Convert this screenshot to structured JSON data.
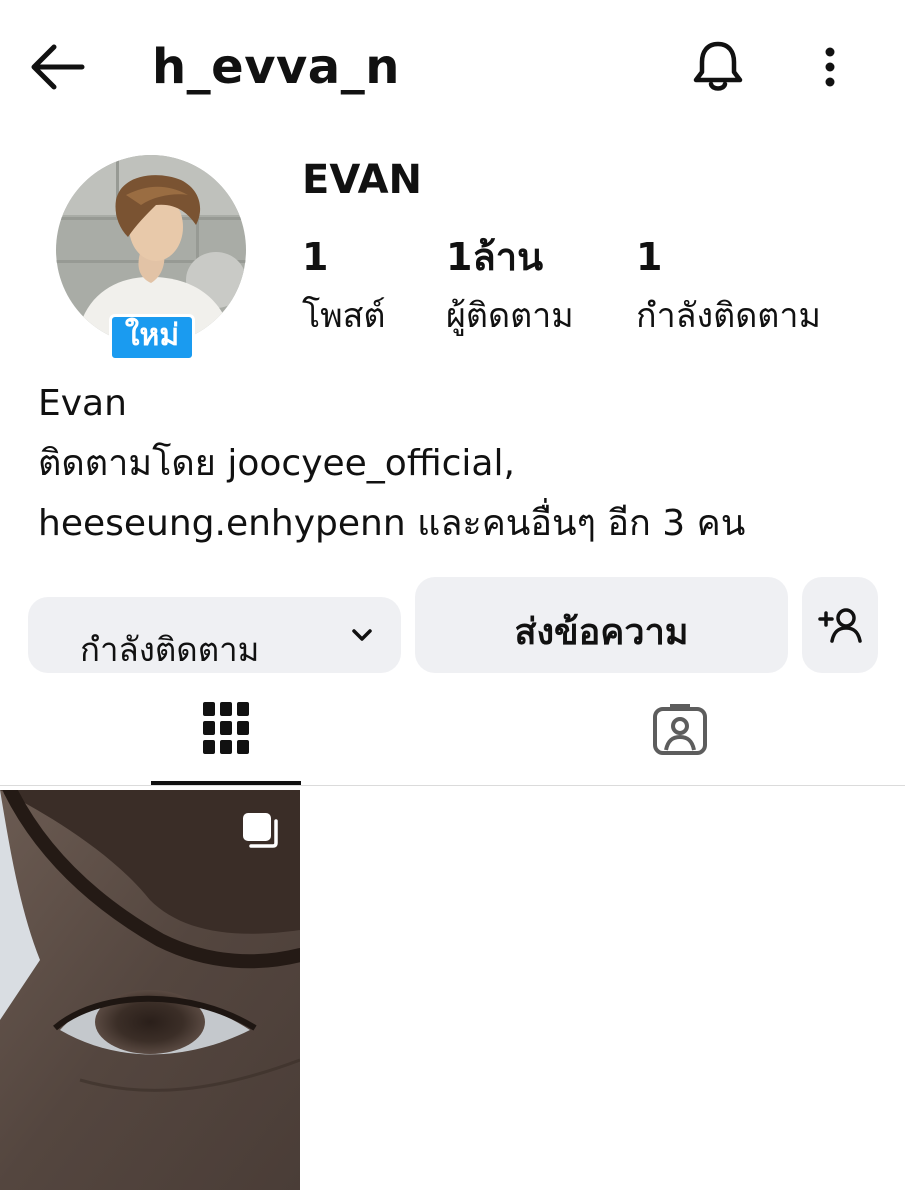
{
  "header": {
    "username": "h_evva_n",
    "icons": {
      "back": "arrow-left-icon",
      "notifications": "bell-icon",
      "more": "more-vertical-icon"
    }
  },
  "profile": {
    "display_name": "EVAN",
    "badge": "ใหม่",
    "stats": [
      {
        "value": "1",
        "label": "โพสต์"
      },
      {
        "value": "1ล้าน",
        "label": "ผู้ติดตาม"
      },
      {
        "value": "1",
        "label": "กำลังติดตาม"
      }
    ],
    "bio": {
      "name": "Evan",
      "followed_by_prefix": "ติดตามโดย",
      "followed_by_user1": "joocyee_official,",
      "followed_by_user2": "heeseung.enhypenn",
      "followed_by_suffix": "และคนอื่นๆ อีก",
      "others_count": "3",
      "others_unit": "คน"
    }
  },
  "actions": {
    "following_label": "กำลังติดตาม",
    "message_label": "ส่งข้อความ",
    "add_user_icon": "add-person-icon"
  },
  "tabs": [
    {
      "icon": "grid-icon",
      "active": true
    },
    {
      "icon": "tagged-person-icon",
      "active": false
    }
  ],
  "posts": [
    {
      "type": "carousel",
      "icon": "multiple-photos-icon"
    }
  ],
  "colors": {
    "badge": "#1a9bf0",
    "button_bg": "#eff0f3",
    "text": "#111111",
    "divider": "#dbdbdb"
  }
}
